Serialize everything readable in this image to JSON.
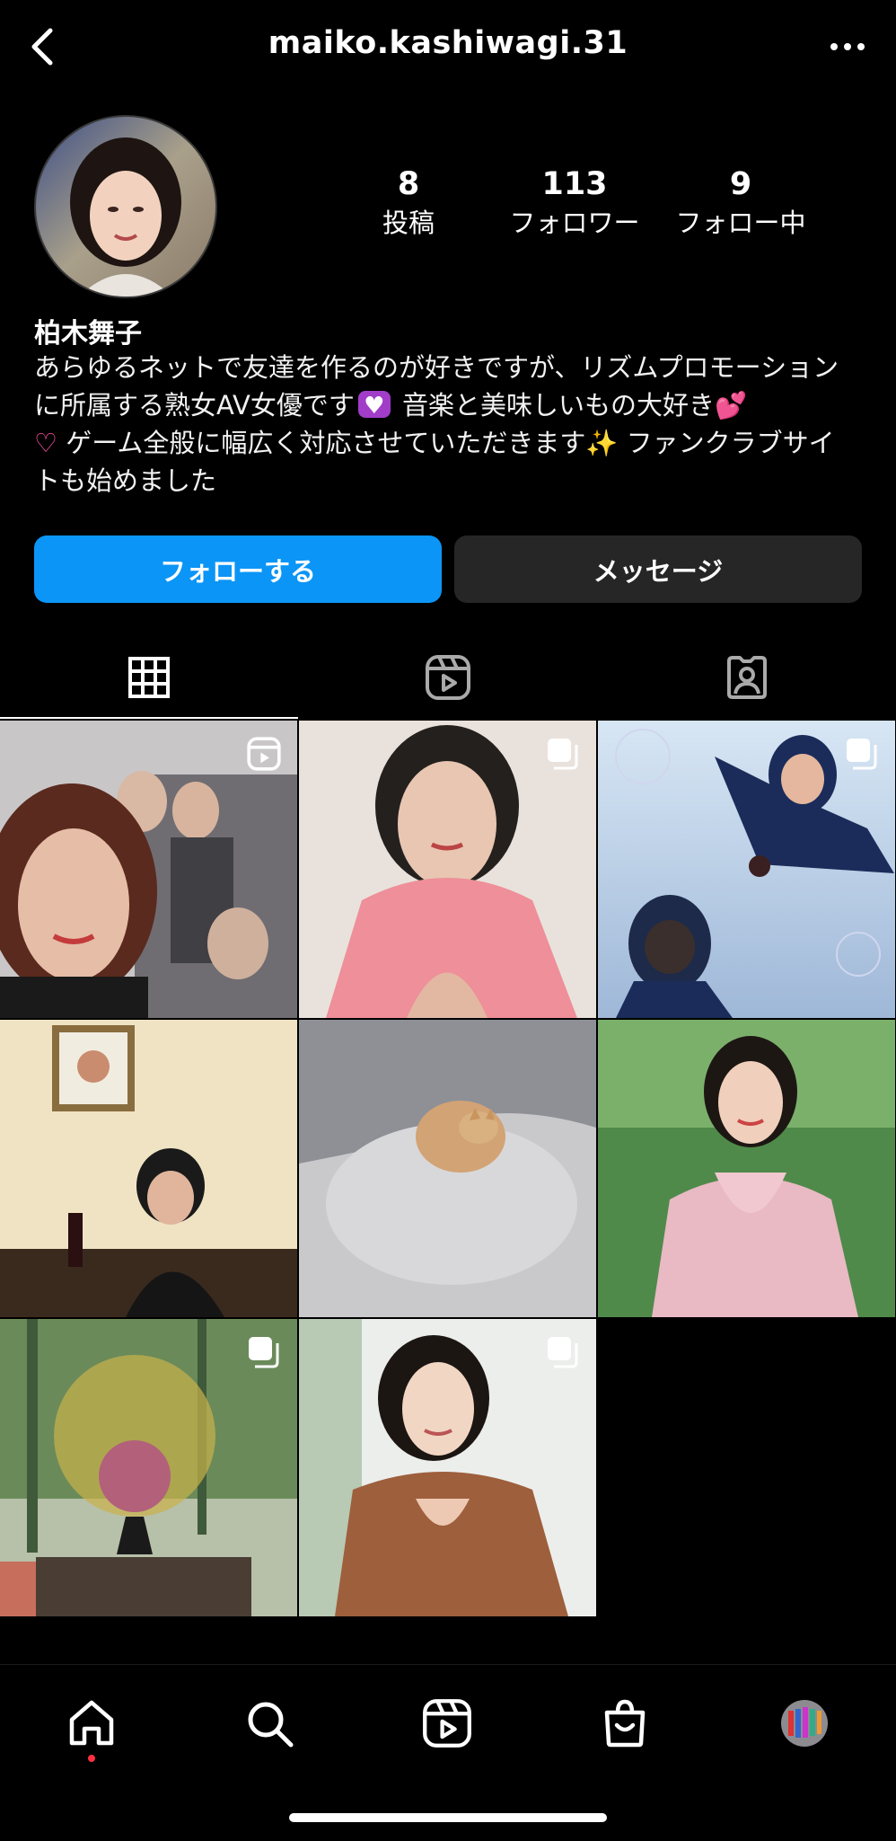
{
  "header": {
    "username": "maiko.kashiwagi.31",
    "back_icon": "chevron-left-icon",
    "more_icon": "more-horizontal-icon"
  },
  "profile": {
    "stats": [
      {
        "value": "8",
        "label": "投稿"
      },
      {
        "value": "113",
        "label": "フォロワー"
      },
      {
        "value": "9",
        "label": "フォロー中"
      }
    ],
    "display_name": "柏木舞子",
    "bio_1": "あらゆるネットで友達を作るのが好きですが、リズムプロモーションに所属する熟女AV女優です",
    "bio_2": " 音楽と美味しいもの大好き",
    "bio_3": " ゲーム全般に幅広く対応させていただきます",
    "bio_4": " ファンクラブサイトも始めました",
    "emoji_hearts": "💕",
    "emoji_sparkles": "✨"
  },
  "actions": {
    "follow_label": "フォローする",
    "message_label": "メッセージ"
  },
  "tabs": [
    "grid-icon",
    "reels-icon",
    "tagged-icon"
  ],
  "grid": [
    {
      "type": "reel"
    },
    {
      "type": "multi"
    },
    {
      "type": "multi"
    },
    {
      "type": "single"
    },
    {
      "type": "single"
    },
    {
      "type": "single"
    },
    {
      "type": "multi"
    },
    {
      "type": "multi"
    }
  ],
  "bottom_nav": [
    "home-icon",
    "search-icon",
    "reels-icon",
    "shop-icon",
    "profile-avatar"
  ],
  "colors": {
    "follow_button": "#0b95f6",
    "message_button": "#262626",
    "background": "#000000",
    "notification_dot": "#ff3040"
  }
}
